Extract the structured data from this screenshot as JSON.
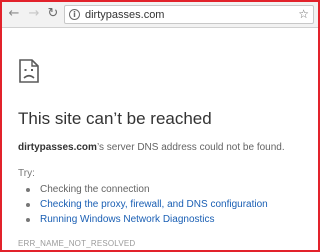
{
  "browser": {
    "url": "dirtypasses.com",
    "icons": {
      "back": "arrow-left-icon",
      "forward": "arrow-right-icon",
      "reload": "reload-icon",
      "info": "info-icon",
      "bookmark": "star-icon"
    }
  },
  "error_page": {
    "icon": "sad-document-icon",
    "title": "This site can’t be reached",
    "domain": "dirtypasses.com",
    "description": "’s server DNS address could not be found.",
    "try_label": "Try:",
    "suggestions": [
      {
        "text": "Checking the connection",
        "is_link": false
      },
      {
        "text": "Checking the proxy, firewall, and DNS configuration",
        "is_link": true
      },
      {
        "text": "Running Windows Network Diagnostics",
        "is_link": true
      }
    ],
    "error_code": "ERR_NAME_NOT_RESOLVED"
  },
  "colors": {
    "frame_border": "#e2222b",
    "link": "#1a5fb4",
    "toolbar_bg": "#f2f2f2"
  }
}
